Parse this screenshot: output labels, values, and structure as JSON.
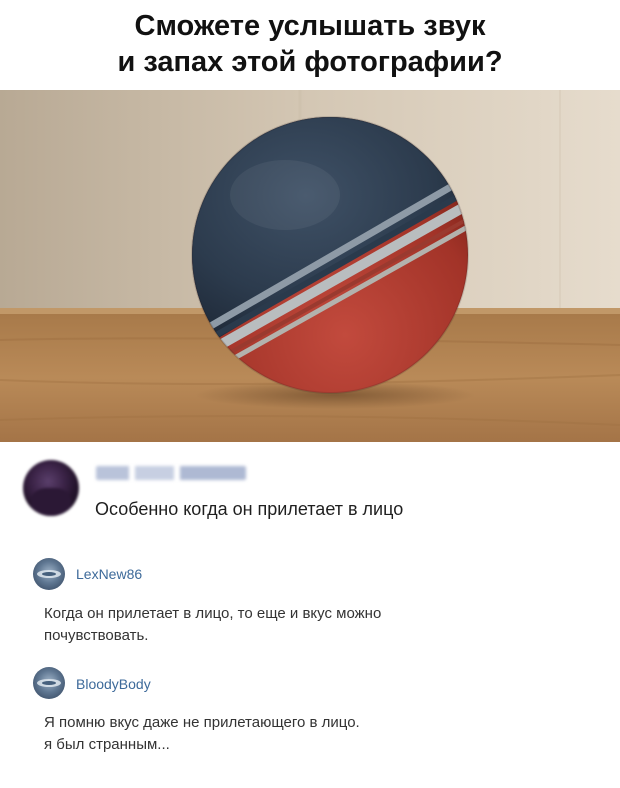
{
  "title": {
    "line1": "Сможете услышать звук",
    "line2": "и запах этой фотографии?"
  },
  "photo": {
    "subject": "ball-photo"
  },
  "comment1": {
    "text": "Особенно когда он прилетает в лицо"
  },
  "reply1": {
    "author": "LexNew86",
    "line1": "Когда он прилетает в лицо, то еще и вкус можно",
    "line2": "почувствовать."
  },
  "reply2": {
    "author": "BloodyBody",
    "line1": "Я помню вкус даже не прилетающего в лицо.",
    "line2": "я был странным..."
  }
}
